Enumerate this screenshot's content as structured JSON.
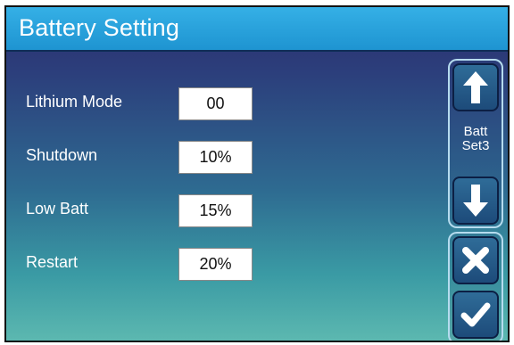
{
  "header": {
    "title": "Battery Setting"
  },
  "settings": [
    {
      "label": "Lithium Mode",
      "value": "00"
    },
    {
      "label": "Shutdown",
      "value": "10%"
    },
    {
      "label": "Low Batt",
      "value": "15%"
    },
    {
      "label": "Restart",
      "value": "20%"
    }
  ],
  "side_panel": {
    "page_label_line1": "Batt",
    "page_label_line2": "Set3",
    "up_icon": "arrow-up-icon",
    "down_icon": "arrow-down-icon",
    "cancel_icon": "close-icon",
    "confirm_icon": "check-icon"
  },
  "colors": {
    "title_bar": "#1e94d1",
    "background_top": "#2a2f6e",
    "background_bottom": "#5cb8b0",
    "text": "#ffffff"
  }
}
